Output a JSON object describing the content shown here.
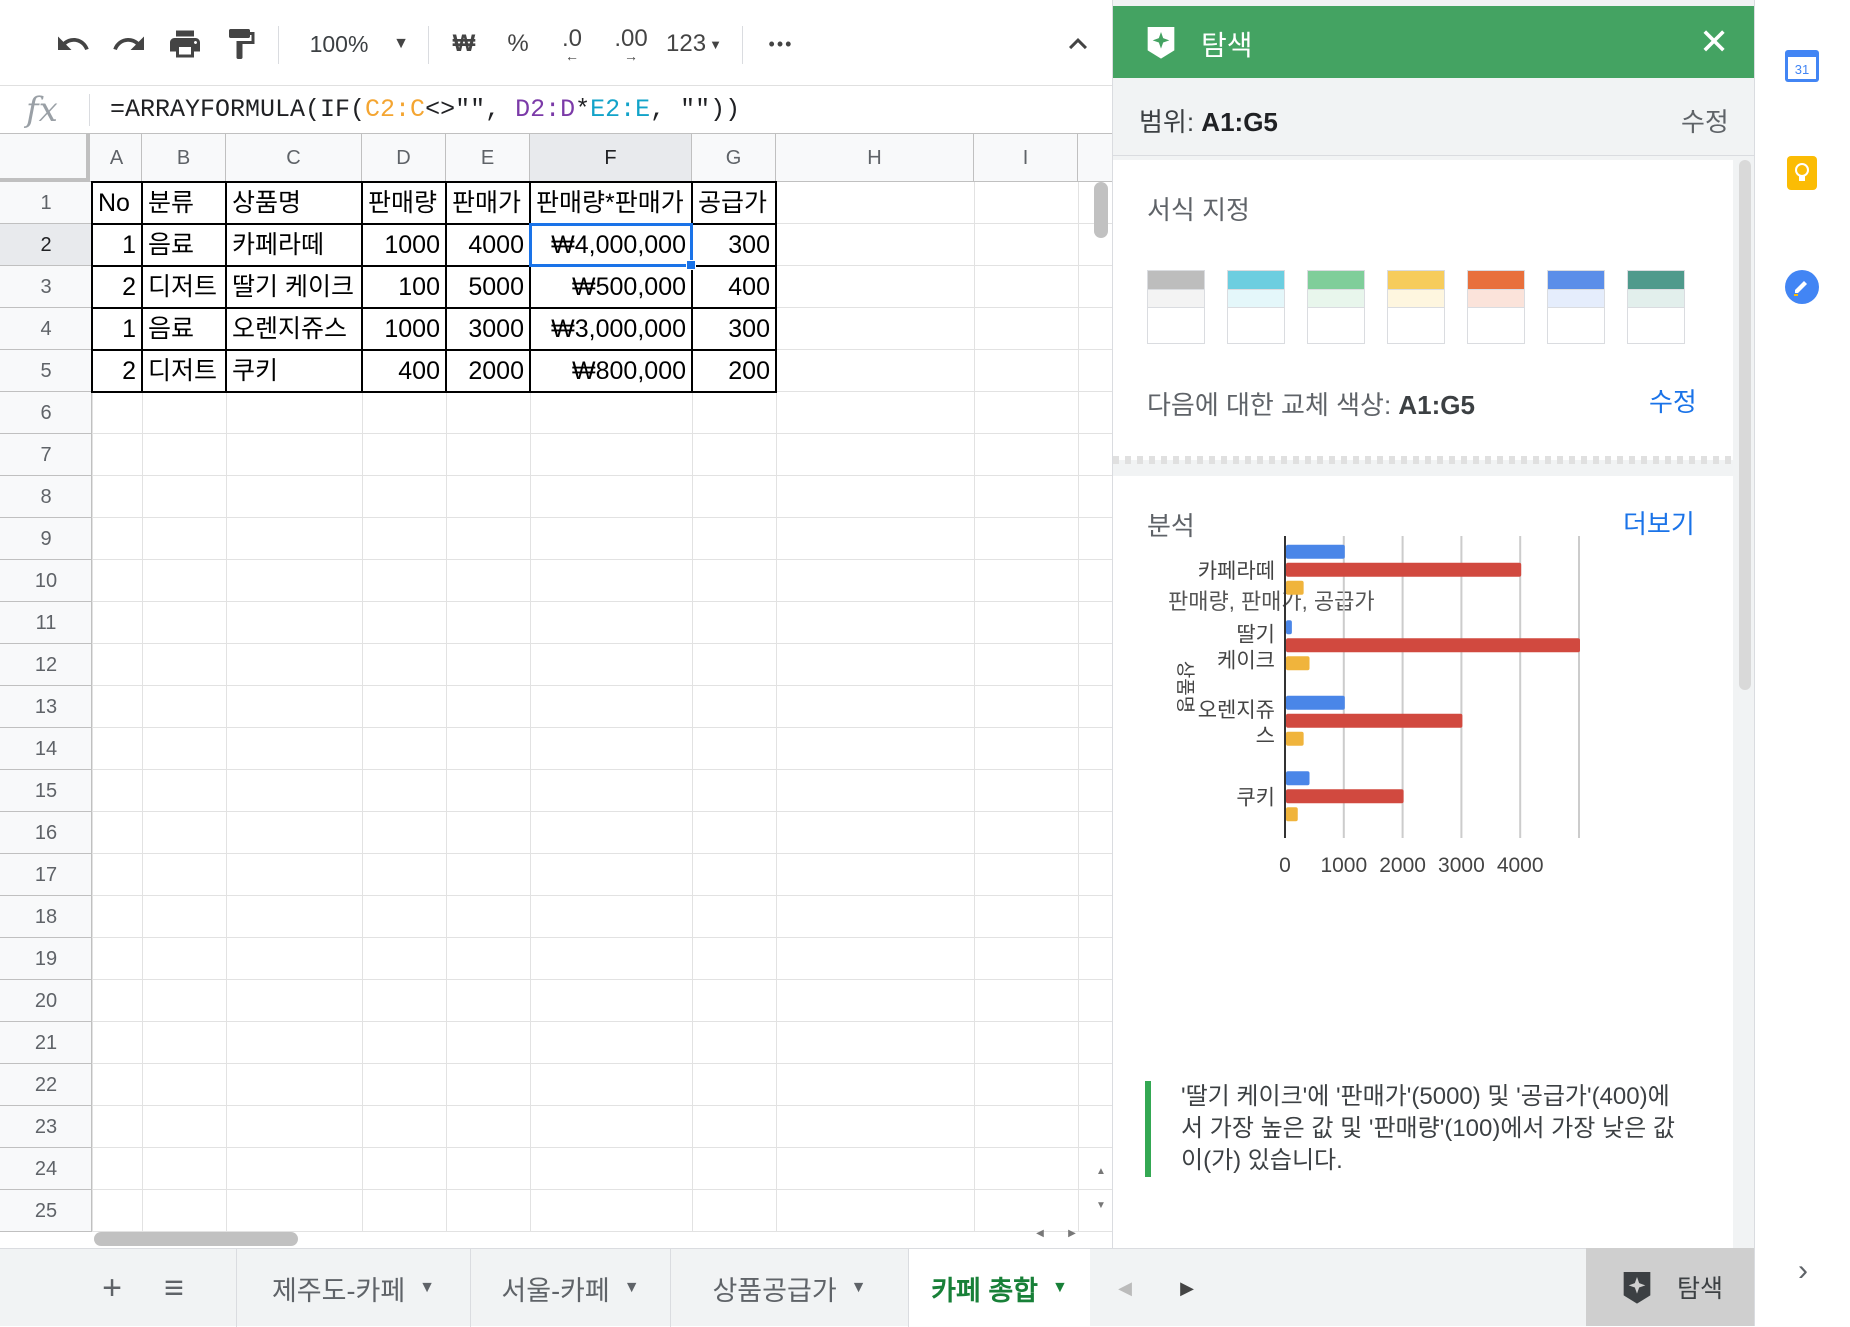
{
  "toolbar": {
    "zoom": "100%",
    "currency": "₩",
    "percent": "%",
    "dec_decrease": ".0",
    "dec_increase": ".00",
    "format_more": "123",
    "more": "•••"
  },
  "formula_bar": {
    "fx": "fx",
    "formula_parts": [
      "=ARRAYFORMULA(IF(",
      "C2:C",
      "<>\"\", ",
      "D2:D",
      "*",
      "E2:E",
      ", \"\"))"
    ]
  },
  "grid": {
    "columns": [
      "A",
      "B",
      "C",
      "D",
      "E",
      "F",
      "G",
      "H",
      "I"
    ],
    "rows": [
      "1",
      "2",
      "3",
      "4",
      "5",
      "6",
      "7",
      "8",
      "9",
      "10",
      "11",
      "12",
      "13",
      "14",
      "15",
      "16",
      "17",
      "18",
      "19",
      "20",
      "21",
      "22",
      "23",
      "24",
      "25"
    ],
    "header": [
      "No",
      "분류",
      "상품명",
      "판매량",
      "판매가",
      "판매량*판매가",
      "공급가"
    ],
    "data": [
      [
        "1",
        "음료",
        "카페라떼",
        "1000",
        "4000",
        "₩4,000,000",
        "300"
      ],
      [
        "2",
        "디저트",
        "딸기 케이크",
        "100",
        "5000",
        "₩500,000",
        "400"
      ],
      [
        "1",
        "음료",
        "오렌지쥬스",
        "1000",
        "3000",
        "₩3,000,000",
        "300"
      ],
      [
        "2",
        "디저트",
        "쿠키",
        "400",
        "2000",
        "₩800,000",
        "200"
      ]
    ],
    "selected_cell": "F2"
  },
  "sheet_tabs": {
    "add": "+",
    "list": "≡",
    "tabs": [
      {
        "label": "제주도-카페",
        "active": false
      },
      {
        "label": "서울-카페",
        "active": false
      },
      {
        "label": "상품공급가",
        "active": false
      },
      {
        "label": "카페 총합",
        "active": true
      }
    ],
    "explore_label": "탐색"
  },
  "explore_panel": {
    "title": "탐색",
    "close": "✕",
    "range_prefix": "범위: ",
    "range_value": "A1:G5",
    "range_edit": "수정",
    "format_title": "서식 지정",
    "swatches": [
      {
        "header": "#bdbdbd",
        "band": "#f3f3f3"
      },
      {
        "header": "#6ccee0",
        "band": "#e4f7fa"
      },
      {
        "header": "#7fce9a",
        "band": "#e8f6ec"
      },
      {
        "header": "#f6cc5c",
        "band": "#fef6df"
      },
      {
        "header": "#e8703c",
        "band": "#fbe3da"
      },
      {
        "header": "#5b8ee9",
        "band": "#e5edfc"
      },
      {
        "header": "#4f9a8c",
        "band": "#e2efec"
      }
    ],
    "alt_color_prefix": "다음에 대한 교체 색상: ",
    "alt_color_range": "A1:G5",
    "alt_color_edit": "수정",
    "analysis_title": "분석",
    "analysis_more": "더보기",
    "insight": "'딸기 케이크'에 '판매가'(5000) 및 '공급가'(400)에서 가장 높은 값 및 '판매량'(100)에서 가장 낮은 값이(가) 있습니다."
  },
  "chart_data": {
    "type": "bar",
    "orientation": "horizontal",
    "title": "판매량, 판매가, 공급가",
    "ylabel": "상품명",
    "categories": [
      "카페라떼",
      "딸기 케이크",
      "오렌지쥬스",
      "쿠키"
    ],
    "category_display": [
      [
        "카페라떼"
      ],
      [
        "딸기",
        "케이크"
      ],
      [
        "오렌지쥬",
        "스"
      ],
      [
        "쿠키"
      ]
    ],
    "series": [
      {
        "name": "판매량",
        "color": "#4a86e8",
        "values": [
          1000,
          100,
          1000,
          400
        ]
      },
      {
        "name": "판매가",
        "color": "#d1493f",
        "values": [
          4000,
          5000,
          3000,
          2000
        ]
      },
      {
        "name": "공급가",
        "color": "#f0b43c",
        "values": [
          300,
          400,
          300,
          200
        ]
      }
    ],
    "xticks": [
      0,
      1000,
      2000,
      3000,
      4000
    ],
    "xlim": [
      0,
      5000
    ],
    "grid": true,
    "legend": "none"
  },
  "colors": {
    "accent_green": "#44a362",
    "selection_blue": "#1a73e8",
    "link_blue": "#1a73e8"
  },
  "icons": {
    "undo": "undo-icon",
    "redo": "redo-icon",
    "print": "print-icon",
    "paint_format": "paint-format-icon",
    "collapse": "chevron-up-icon",
    "explore": "explore-sparkle-icon",
    "calendar": "calendar-icon",
    "keep": "keep-icon",
    "tasks": "tasks-icon",
    "expand_rail": "chevron-right-icon"
  },
  "side_rail": {
    "calendar_day": "31"
  }
}
